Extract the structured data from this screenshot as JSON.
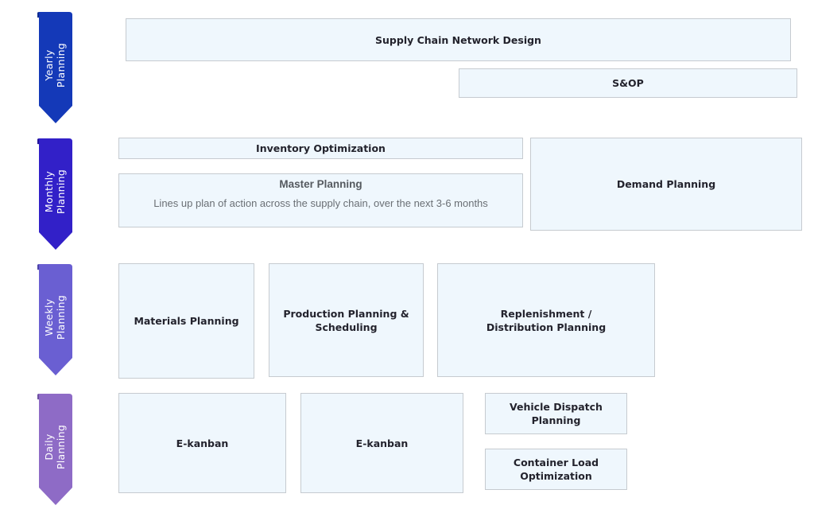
{
  "diagram": {
    "tiers": [
      {
        "id": "yearly",
        "label": "Yearly\nPlanning",
        "color": "#1439b8"
      },
      {
        "id": "monthly",
        "label": "Monthly\nPlanning",
        "color": "#3220c8"
      },
      {
        "id": "weekly",
        "label": "Weekly\nPlanning",
        "color": "#6a5fd2"
      },
      {
        "id": "daily",
        "label": "Daily\nPlanning",
        "color": "#8e6bc6"
      }
    ],
    "boxes": {
      "supply_chain_network_design": {
        "title": "Supply Chain Network Design"
      },
      "sop": {
        "title": "S&OP"
      },
      "inventory_optimization": {
        "title": "Inventory Optimization"
      },
      "master_planning": {
        "title": "Master Planning",
        "description": "Lines up plan of action across the supply chain, over the next 3-6 months"
      },
      "demand_planning": {
        "title": "Demand Planning"
      },
      "materials_planning": {
        "title": "Materials Planning"
      },
      "production_planning": {
        "title": "Production Planning &\nScheduling"
      },
      "replenishment_planning": {
        "title": "Replenishment /\nDistribution Planning"
      },
      "ekanban_1": {
        "title": "E-kanban"
      },
      "ekanban_2": {
        "title": "E-kanban"
      },
      "vehicle_dispatch": {
        "title": "Vehicle Dispatch\nPlanning"
      },
      "container_load": {
        "title": "Container Load\nOptimization"
      }
    },
    "colors": {
      "box_fill": "#eff7fd",
      "box_border": "#c6cbd0",
      "text": "#23232d"
    }
  }
}
